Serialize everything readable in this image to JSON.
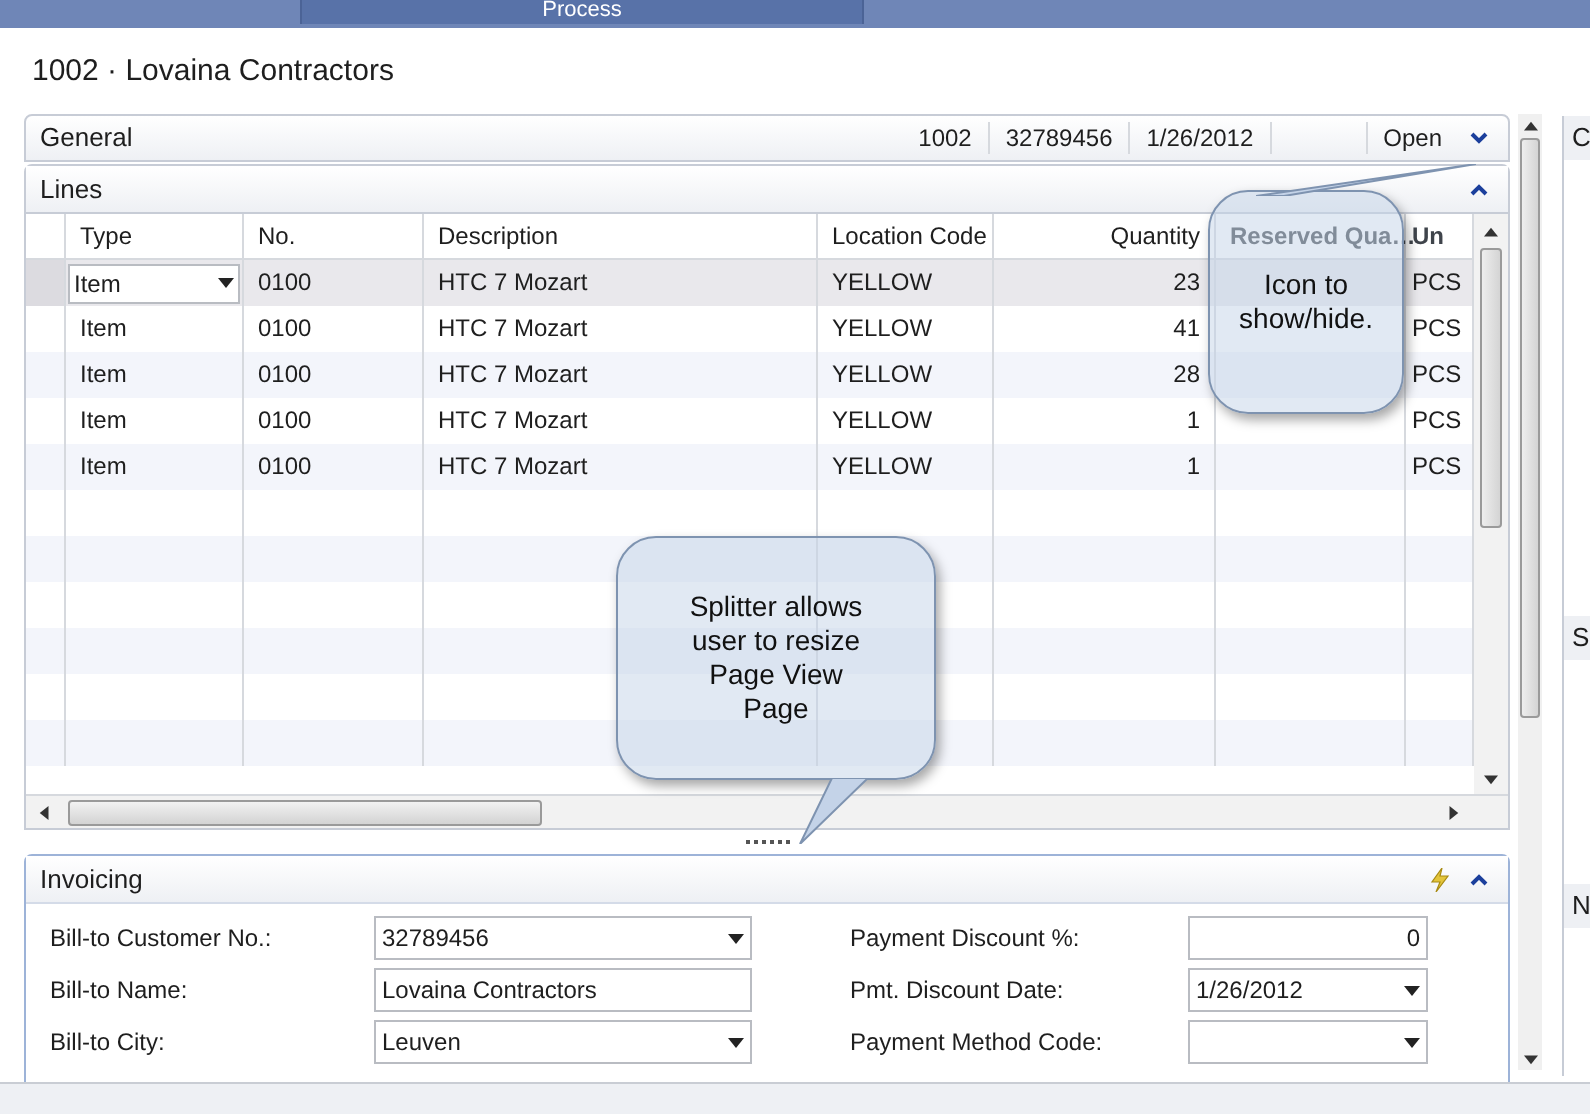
{
  "top_tab": "Process",
  "title": "1002 · Lovaina Contractors",
  "general": {
    "label": "General",
    "summary": [
      "1002",
      "32789456",
      "1/26/2012",
      "Open"
    ],
    "expanded": false
  },
  "lines": {
    "label": "Lines",
    "expanded": true,
    "columns": [
      "Type",
      "No.",
      "Description",
      "Location Code",
      "Quantity",
      "Reserved Qua…",
      "Un"
    ],
    "rows": [
      {
        "selected": true,
        "cells": [
          "Item",
          "0100",
          "HTC 7 Mozart",
          "YELLOW",
          "23",
          "",
          "PCS"
        ]
      },
      {
        "selected": false,
        "cells": [
          "Item",
          "0100",
          "HTC 7 Mozart",
          "YELLOW",
          "41",
          "",
          "PCS"
        ]
      },
      {
        "selected": false,
        "cells": [
          "Item",
          "0100",
          "HTC 7 Mozart",
          "YELLOW",
          "28",
          "",
          "PCS"
        ]
      },
      {
        "selected": false,
        "cells": [
          "Item",
          "0100",
          "HTC 7 Mozart",
          "YELLOW",
          "1",
          "",
          "PCS"
        ]
      },
      {
        "selected": false,
        "cells": [
          "Item",
          "0100",
          "HTC 7 Mozart",
          "YELLOW",
          "1",
          "",
          "PCS"
        ]
      }
    ]
  },
  "invoicing": {
    "label": "Invoicing",
    "expanded": true,
    "left": [
      {
        "label": "Bill-to Customer No.:",
        "value": "32789456",
        "dropdown": true,
        "numeric": false
      },
      {
        "label": "Bill-to Name:",
        "value": "Lovaina Contractors",
        "dropdown": false,
        "numeric": false
      },
      {
        "label": "Bill-to City:",
        "value": "Leuven",
        "dropdown": true,
        "numeric": false
      }
    ],
    "right": [
      {
        "label": "Payment Discount %:",
        "value": "0",
        "dropdown": false,
        "numeric": true
      },
      {
        "label": "Pmt. Discount Date:",
        "value": "1/26/2012",
        "dropdown": true,
        "numeric": false
      },
      {
        "label": "Payment Method Code:",
        "dropdown": true,
        "numeric": false
      }
    ]
  },
  "factbox_headers": [
    "C",
    "S",
    "N"
  ],
  "callouts": [
    {
      "text": "Icon to show/hide."
    },
    {
      "text": "Splitter allows user to resize Page View Page"
    }
  ]
}
